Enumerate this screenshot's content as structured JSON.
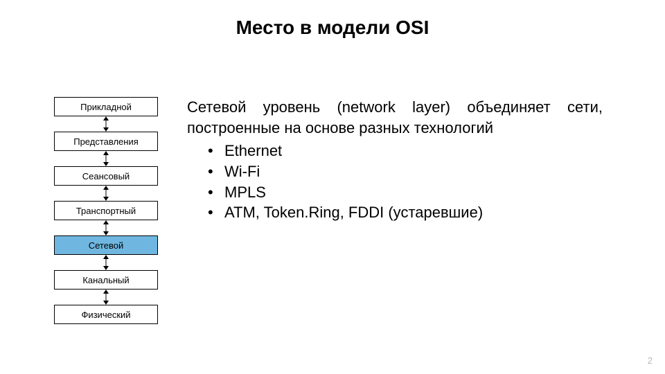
{
  "title": "Место в модели OSI",
  "layers": [
    {
      "label": "Прикладной",
      "highlight": false
    },
    {
      "label": "Представления",
      "highlight": false
    },
    {
      "label": "Сеансовый",
      "highlight": false
    },
    {
      "label": "Транспортный",
      "highlight": false
    },
    {
      "label": "Сетевой",
      "highlight": true
    },
    {
      "label": "Канальный",
      "highlight": false
    },
    {
      "label": "Физический",
      "highlight": false
    }
  ],
  "body": {
    "text": "Сетевой уровень (network layer) объединяет сети, построенные на основе разных технологий",
    "bullets": [
      "Ethernet",
      "Wi-Fi",
      "MPLS",
      "ATM, Token.Ring, FDDI (устаревшие)"
    ]
  },
  "page_number": "2"
}
